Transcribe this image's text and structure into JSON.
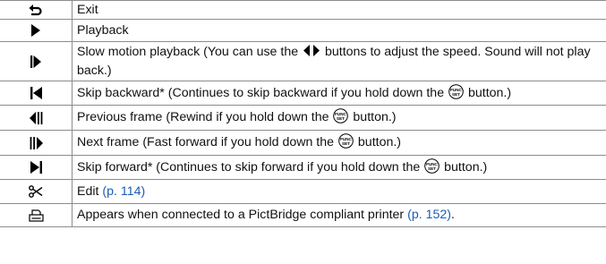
{
  "rows": [
    {
      "icon": "return-icon",
      "text": "Exit"
    },
    {
      "icon": "play-icon",
      "text": "Playback"
    },
    {
      "icon": "slow-motion-icon",
      "text_a": "Slow motion playback (You can use the ",
      "text_b": " buttons to adjust the speed. Sound will not play back.)"
    },
    {
      "icon": "skip-backward-icon",
      "text_a": "Skip backward* (Continues to skip backward if you hold down the ",
      "text_b": " button.)"
    },
    {
      "icon": "previous-frame-icon",
      "text_a": "Previous frame (Rewind if you hold down the ",
      "text_b": " button.)"
    },
    {
      "icon": "next-frame-icon",
      "text_a": "Next frame (Fast forward if you hold down the ",
      "text_b": " button.)"
    },
    {
      "icon": "skip-forward-icon",
      "text_a": "Skip forward* (Continues to skip forward if you hold down the ",
      "text_b": " button.)"
    },
    {
      "icon": "scissors-icon",
      "text": "Edit ",
      "link": "(p. 114)"
    },
    {
      "icon": "print-icon",
      "text": "Appears when connected to a PictBridge compliant printer ",
      "link": "(p. 152)",
      "tail": "."
    }
  ],
  "func_button_label": "FUNC SET",
  "colors": {
    "link": "#1a5db4",
    "border": "#8c8c8c"
  }
}
